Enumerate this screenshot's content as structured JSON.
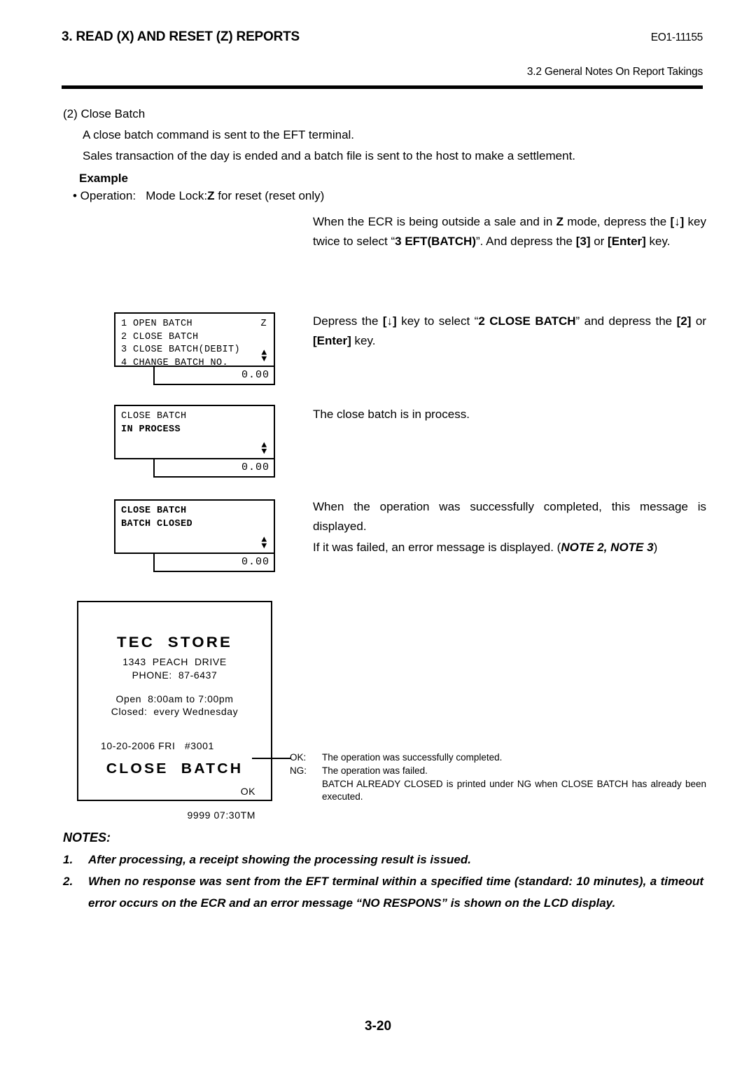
{
  "header": {
    "title": "3. READ (X) AND RESET (Z) REPORTS",
    "doc_code": "EO1-11155",
    "section": "3.2 General Notes On Report Takings"
  },
  "intro": {
    "heading": "(2) Close Batch",
    "line1": "A close batch command is sent to the EFT terminal.",
    "line2": "Sales transaction of the day is ended and a batch file is sent to the host to make a settlement.",
    "example_label": "Example",
    "operation_label": "• Operation:   Mode Lock:",
    "operation_mode": "Z",
    "operation_rest": " for reset (reset only)"
  },
  "instructions": {
    "step1": {
      "a": "When the ECR is being outside a sale and in ",
      "b1": "Z",
      "c": " mode, depress the ",
      "b2": "[↓]",
      "d": " key twice to select “",
      "b3": "3 EFT(BATCH)",
      "e": "”.  And depress the ",
      "b4": "[3]",
      "f": " or ",
      "b5": "[Enter]",
      "g": " key."
    },
    "step2": {
      "a": "Depress the ",
      "b1": "[↓]",
      "c": " key to select “",
      "b2": "2 CLOSE BATCH",
      "d": "” and depress the ",
      "b3": "[2]",
      "e": " or ",
      "b4": "[Enter]",
      "f": " key."
    },
    "step3": "The close batch is in process.",
    "step4": "When the operation was successfully completed, this message is displayed.",
    "step5": {
      "a": "If it was failed, an error message is displayed. (",
      "b": "NOTE 2, NOTE 3",
      "c": ")"
    }
  },
  "lcd_displays": [
    {
      "name": "menu-display",
      "rows": [
        {
          "text": "1 OPEN BATCH",
          "right": "Z",
          "highlight": false,
          "bold": false
        },
        {
          "text": "2 CLOSE BATCH",
          "right": "",
          "highlight": true,
          "bold": false
        },
        {
          "text": "3 CLOSE BATCH(DEBIT)",
          "right": "",
          "highlight": false,
          "bold": false
        },
        {
          "text": "4 CHANGE BATCH NO.",
          "right": "",
          "highlight": false,
          "bold": false
        }
      ],
      "amount": "0.00",
      "scroll_arrows": "up-down-arrow-icon"
    },
    {
      "name": "in-process-display",
      "rows": [
        {
          "text": "CLOSE BATCH",
          "right": "",
          "highlight": false,
          "bold": false
        },
        {
          "text": "IN PROCESS",
          "right": "",
          "highlight": false,
          "bold": true
        }
      ],
      "amount": "0.00",
      "scroll_arrows": "up-down-arrow-icon"
    },
    {
      "name": "batch-closed-display",
      "rows": [
        {
          "text": "CLOSE BATCH",
          "right": "",
          "highlight": false,
          "bold": true
        },
        {
          "text": "BATCH CLOSED",
          "right": "",
          "highlight": false,
          "bold": true
        }
      ],
      "amount": "0.00",
      "scroll_arrows": "up-down-arrow-icon"
    }
  ],
  "receipt": {
    "store": "TEC  STORE",
    "address": "1343  PEACH  DRIVE",
    "phone": "PHONE:  87-6437",
    "open_hours": "Open  8:00am to 7:00pm",
    "closed": "Closed:  every Wednesday",
    "date": "10-20-2006 FRI   #3001",
    "title": "CLOSE  BATCH",
    "status": "OK",
    "time": "9999 07:30TM"
  },
  "receipt_notes": {
    "ok_label": "OK:",
    "ok_text": "The operation was successfully completed.",
    "ng_label": "NG:",
    "ng_text": "The operation was failed.",
    "ng_detail": "BATCH ALREADY CLOSED is printed under NG when CLOSE BATCH has already been",
    "ng_detail2": "executed."
  },
  "notes": {
    "heading": "NOTES:",
    "items": [
      {
        "num": "1.",
        "text": "After processing, a receipt showing the processing result is issued."
      },
      {
        "num": "2.",
        "text": "When no response was sent from the EFT terminal within a specified time (standard: 10 minutes), a timeout error occurs on the ECR and an error message “NO RESPONS” is shown on the LCD display."
      }
    ]
  },
  "page_number": "3-20"
}
